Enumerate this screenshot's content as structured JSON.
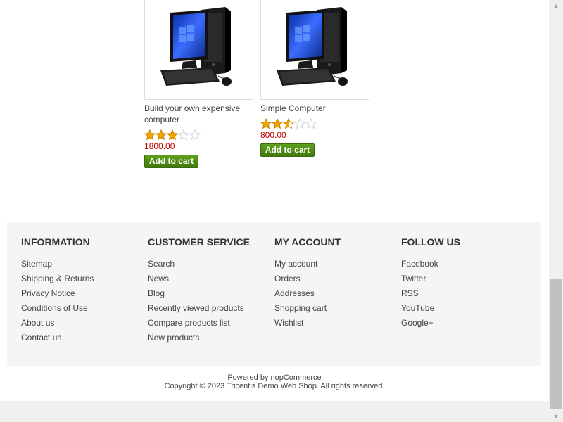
{
  "products": [
    {
      "title": "Build your own expensive computer",
      "rating": 3,
      "price": "1800.00",
      "button_label": "Add to cart"
    },
    {
      "title": "Simple Computer",
      "rating": 2.5,
      "price": "800.00",
      "button_label": "Add to cart"
    }
  ],
  "footer": {
    "information": {
      "heading": "INFORMATION",
      "links": [
        "Sitemap",
        "Shipping & Returns",
        "Privacy Notice",
        "Conditions of Use",
        "About us",
        "Contact us"
      ]
    },
    "customer_service": {
      "heading": "CUSTOMER SERVICE",
      "links": [
        "Search",
        "News",
        "Blog",
        "Recently viewed products",
        "Compare products list",
        "New products"
      ]
    },
    "my_account": {
      "heading": "MY ACCOUNT",
      "links": [
        "My account",
        "Orders",
        "Addresses",
        "Shopping cart",
        "Wishlist"
      ]
    },
    "follow_us": {
      "heading": "FOLLOW US",
      "links": [
        "Facebook",
        "Twitter",
        "RSS",
        "YouTube",
        "Google+"
      ]
    },
    "powered_by": "Powered by nopCommerce",
    "copyright": "Copyright © 2023 Tricentis Demo Web Shop. All rights reserved."
  },
  "colors": {
    "price": "#c00000",
    "button": "#4e8c15",
    "star_filled": "#f5a300",
    "star_empty": "#d0d0d0",
    "footer_bg": "#f5f5f3"
  },
  "icons": {
    "star": "star-icon",
    "scroll_up": "scroll-up-arrow-icon",
    "scroll_down": "scroll-down-arrow-icon"
  }
}
